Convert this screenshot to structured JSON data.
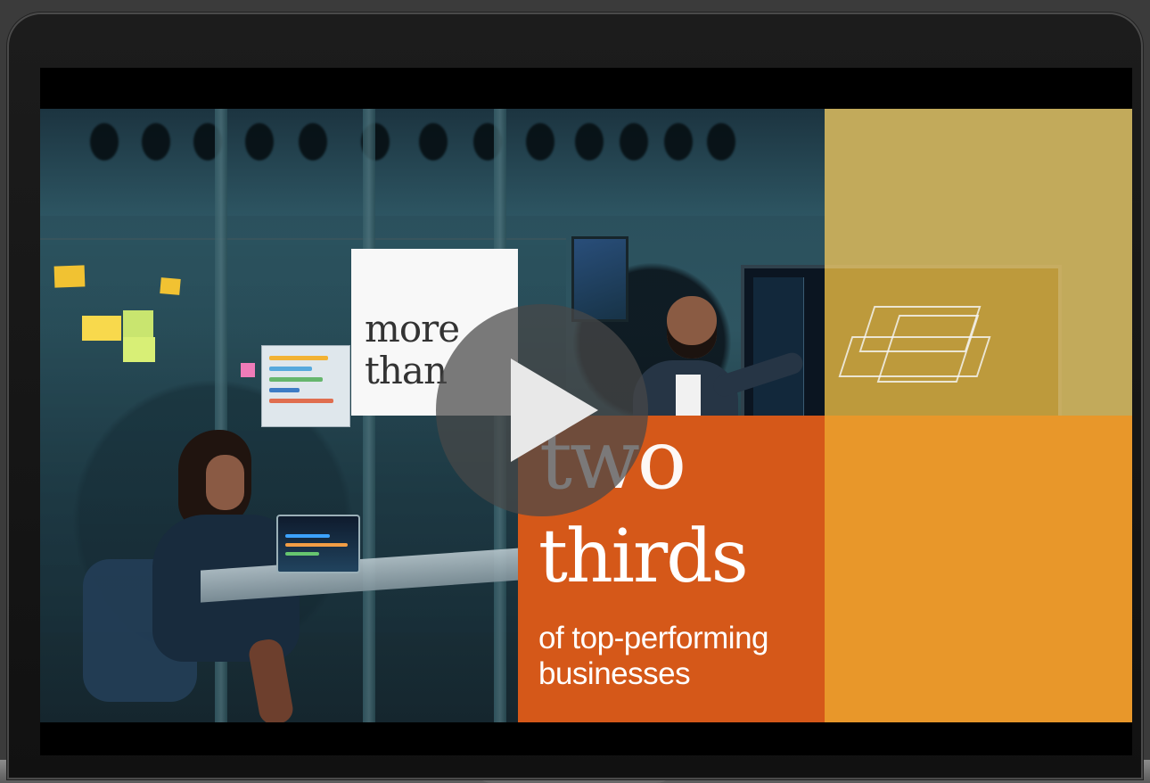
{
  "video": {
    "headline_small": "more\nthan",
    "headline_large_line1": "two",
    "headline_large_line2": "thirds",
    "subheadline": "of top-performing\nbusinesses"
  },
  "controls": {
    "play_label": "Play video"
  },
  "colors": {
    "orange": "#d55819",
    "amber": "#e8972a",
    "gold_overlay": "#d4a523",
    "white_card": "#f8f8f8"
  },
  "icons": {
    "play": "play-icon"
  }
}
